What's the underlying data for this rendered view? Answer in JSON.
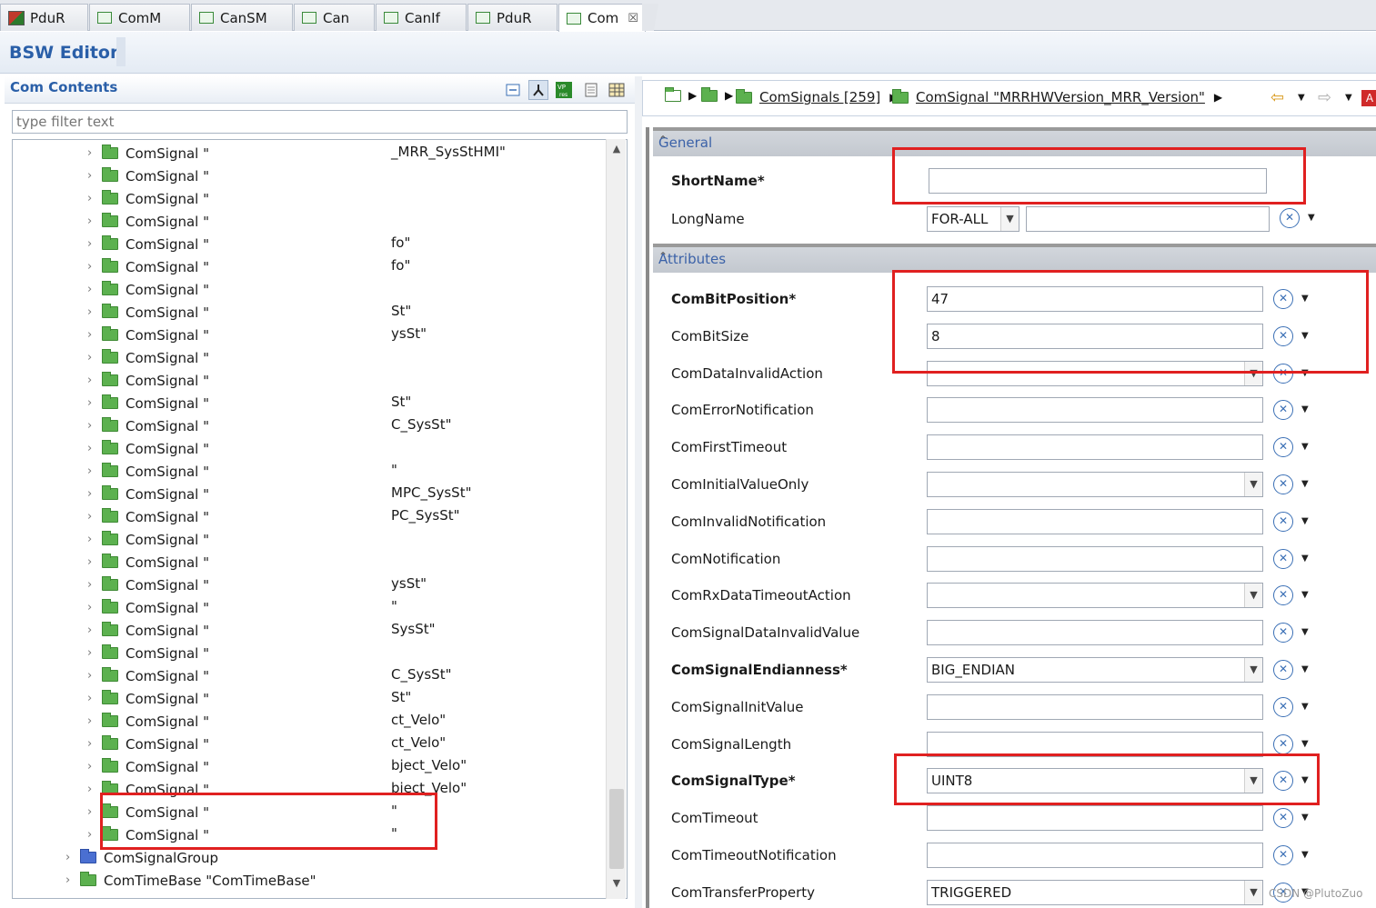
{
  "tabs": [
    {
      "label": "PduR"
    },
    {
      "label": "ComM"
    },
    {
      "label": "CanSM"
    },
    {
      "label": "Can"
    },
    {
      "label": "CanIf"
    },
    {
      "label": "PduR"
    },
    {
      "label": "Com"
    }
  ],
  "editor": {
    "title": "BSW Editor"
  },
  "left": {
    "title": "Com Contents",
    "filter_placeholder": "type filter text",
    "tree_rows": [
      {
        "label": "ComSignal \"",
        "suffix": "_MRR_SysStHMI\""
      },
      {
        "label": "ComSignal \"",
        "suffix": ""
      },
      {
        "label": "ComSignal \"",
        "suffix": ""
      },
      {
        "label": "ComSignal \"",
        "suffix": ""
      },
      {
        "label": "ComSignal \"",
        "suffix": "fo\""
      },
      {
        "label": "ComSignal \"",
        "suffix": "fo\""
      },
      {
        "label": "ComSignal \"",
        "suffix": ""
      },
      {
        "label": "ComSignal \"",
        "suffix": "St\""
      },
      {
        "label": "ComSignal \"",
        "suffix": "ysSt\""
      },
      {
        "label": "ComSignal \"",
        "suffix": ""
      },
      {
        "label": "ComSignal \"",
        "suffix": ""
      },
      {
        "label": "ComSignal \"",
        "suffix": "St\""
      },
      {
        "label": "ComSignal \"",
        "suffix": "C_SysSt\""
      },
      {
        "label": "ComSignal \"",
        "suffix": ""
      },
      {
        "label": "ComSignal \"",
        "suffix": "\""
      },
      {
        "label": "ComSignal \"",
        "suffix": "MPC_SysSt\""
      },
      {
        "label": "ComSignal \"",
        "suffix": "PC_SysSt\""
      },
      {
        "label": "ComSignal \"",
        "suffix": ""
      },
      {
        "label": "ComSignal \"",
        "suffix": ""
      },
      {
        "label": "ComSignal \"",
        "suffix": "ysSt\""
      },
      {
        "label": "ComSignal \"",
        "suffix": "\""
      },
      {
        "label": "ComSignal \"",
        "suffix": "SysSt\""
      },
      {
        "label": "ComSignal \"",
        "suffix": ""
      },
      {
        "label": "ComSignal \"",
        "suffix": "C_SysSt\""
      },
      {
        "label": "ComSignal \"",
        "suffix": "St\""
      },
      {
        "label": "ComSignal \"",
        "suffix": "ct_Velo\""
      },
      {
        "label": "ComSignal \"",
        "suffix": "ct_Velo\""
      },
      {
        "label": "ComSignal \"",
        "suffix": "bject_Velo\""
      },
      {
        "label": "ComSignal \"",
        "suffix": "bject_Velo\""
      },
      {
        "label": "ComSignal \"",
        "suffix": "\""
      },
      {
        "label": "ComSignal \"",
        "suffix": "\""
      }
    ],
    "group_rows": [
      {
        "label": "ComSignalGroup"
      },
      {
        "label": "ComTimeBase \"ComTimeBase\""
      }
    ]
  },
  "breadcrumb": {
    "items": [
      "ComSignals [259]",
      "ComSignal \"MRRHWVersion_MRR_Version\""
    ]
  },
  "sections": {
    "general": "General",
    "attributes": "Attributes"
  },
  "general_fields": {
    "shortname_label": "ShortName*",
    "longname_label": "LongName",
    "longname_lang": "FOR-ALL"
  },
  "attributes": [
    {
      "label": "ComBitPosition*",
      "value": "47",
      "combo": false,
      "required": true
    },
    {
      "label": "ComBitSize",
      "value": "8",
      "combo": false,
      "required": false
    },
    {
      "label": "ComDataInvalidAction",
      "value": "",
      "combo": true,
      "required": false
    },
    {
      "label": "ComErrorNotification",
      "value": "",
      "combo": false,
      "required": false
    },
    {
      "label": "ComFirstTimeout",
      "value": "",
      "combo": false,
      "required": false
    },
    {
      "label": "ComInitialValueOnly",
      "value": "",
      "combo": true,
      "required": false
    },
    {
      "label": "ComInvalidNotification",
      "value": "",
      "combo": false,
      "required": false
    },
    {
      "label": "ComNotification",
      "value": "",
      "combo": false,
      "required": false
    },
    {
      "label": "ComRxDataTimeoutAction",
      "value": "",
      "combo": true,
      "required": false
    },
    {
      "label": "ComSignalDataInvalidValue",
      "value": "",
      "combo": false,
      "required": false
    },
    {
      "label": "ComSignalEndianness*",
      "value": "BIG_ENDIAN",
      "combo": true,
      "required": true
    },
    {
      "label": "ComSignalInitValue",
      "value": "",
      "combo": false,
      "required": false
    },
    {
      "label": "ComSignalLength",
      "value": "",
      "combo": false,
      "required": false
    },
    {
      "label": "ComSignalType*",
      "value": "UINT8",
      "combo": true,
      "required": true
    },
    {
      "label": "ComTimeout",
      "value": "",
      "combo": false,
      "required": false
    },
    {
      "label": "ComTimeoutNotification",
      "value": "",
      "combo": false,
      "required": false
    },
    {
      "label": "ComTransferProperty",
      "value": "TRIGGERED",
      "combo": true,
      "required": false
    }
  ],
  "watermark": "CSDN @PlutoZuo",
  "colors": {
    "accent": "#2a5fa8",
    "highlight_box": "#e02020",
    "folder_green": "#5cb14f"
  }
}
